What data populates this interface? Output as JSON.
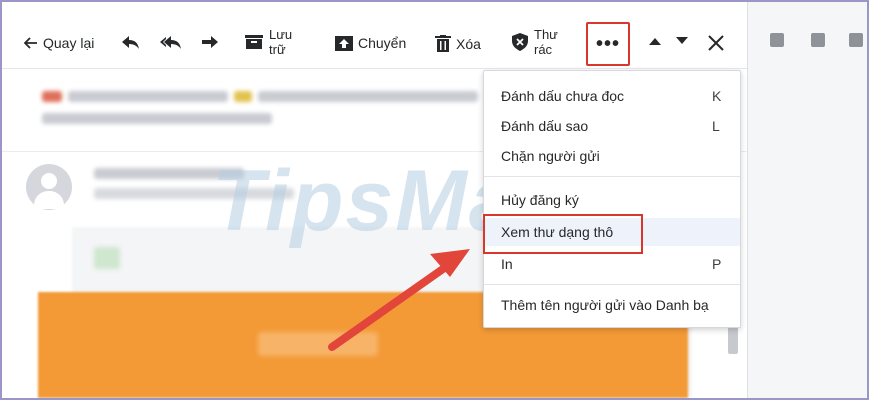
{
  "toolbar": {
    "back_label": "Quay lại",
    "archive_label_line1": "Lưu",
    "archive_label_line2": "trữ",
    "move_label": "Chuyển",
    "delete_label": "Xóa",
    "spam_label_line1": "Thư",
    "spam_label_line2": "rác",
    "more_label": "•••"
  },
  "menu": {
    "items": [
      {
        "label": "Đánh dấu chưa đọc",
        "shortcut": "K"
      },
      {
        "label": "Đánh dấu sao",
        "shortcut": "L"
      },
      {
        "label": "Chặn người gửi",
        "shortcut": ""
      },
      {
        "label": "Hủy đăng ký",
        "shortcut": ""
      },
      {
        "label": "Xem thư dạng thô",
        "shortcut": ""
      },
      {
        "label": "In",
        "shortcut": "P"
      },
      {
        "label": "Thêm tên người gửi vào Danh bạ",
        "shortcut": ""
      }
    ]
  },
  "watermark": "TipsMake",
  "colors": {
    "highlight_red": "#d9362c",
    "arrow_red": "#e2453a",
    "accent_orange": "#f39a37",
    "frame_border": "#9b96c8"
  },
  "icons": [
    "back-arrow-icon",
    "reply-icon",
    "reply-all-icon",
    "forward-icon",
    "archive-icon",
    "move-icon",
    "trash-icon",
    "shield-icon",
    "more-icon",
    "chevron-up-icon",
    "chevron-down-icon",
    "close-icon"
  ]
}
